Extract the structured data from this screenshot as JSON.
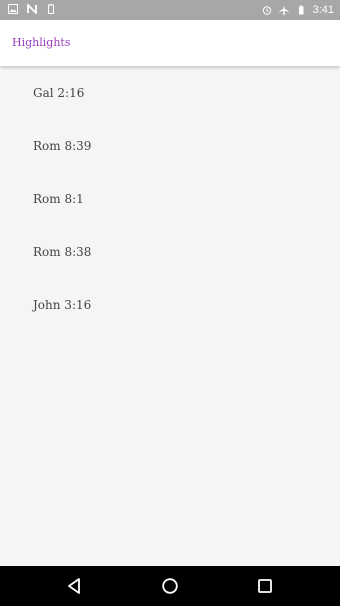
{
  "status_bar": {
    "time": "3:41",
    "left_icons": [
      "image-icon",
      "n-icon",
      "battery-saver-icon"
    ],
    "right_icons": [
      "alarm-icon",
      "airplane-icon",
      "battery-icon"
    ]
  },
  "app_bar": {
    "title": "Highlights",
    "title_color": "#9c3fbf"
  },
  "highlights": [
    "Gal 2:16",
    "Rom 8:39",
    "Rom 8:1",
    "Rom 8:38",
    "John 3:16"
  ],
  "nav_bar": {
    "buttons": [
      "back-icon",
      "home-icon",
      "recents-icon"
    ]
  }
}
